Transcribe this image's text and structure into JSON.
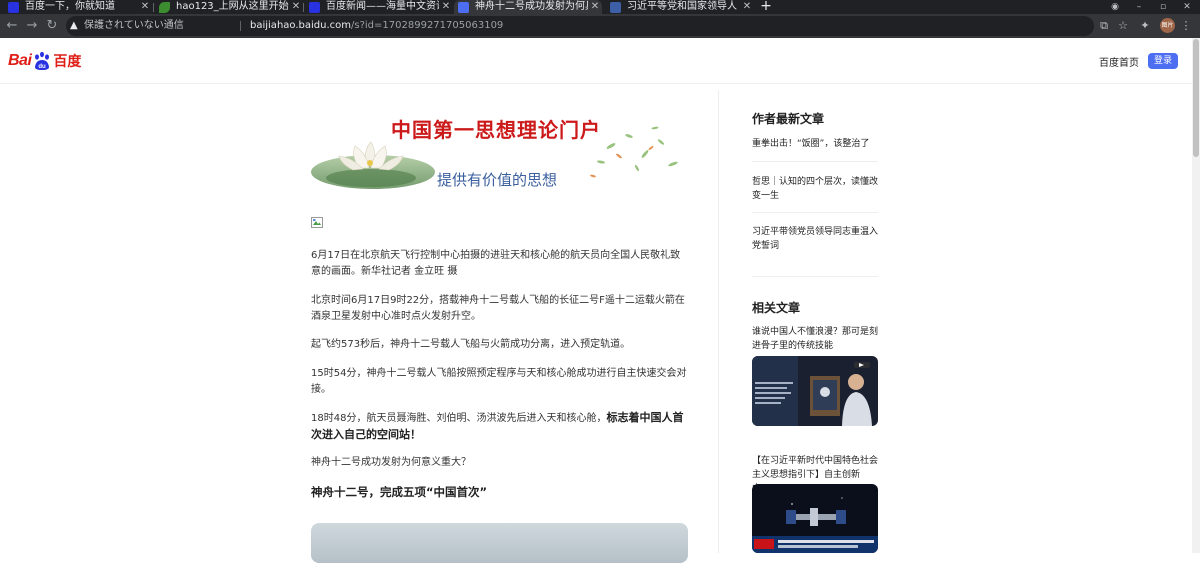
{
  "browser": {
    "tabs": [
      {
        "title": "百度一下，你就知道",
        "active": false
      },
      {
        "title": "hao123_上网从这里开始",
        "active": false
      },
      {
        "title": "百度新闻——海量中文资讯",
        "active": false
      },
      {
        "title": "神舟十二号成功发射为何具",
        "active": true
      },
      {
        "title": "习近平等党和国家领导人",
        "active": false
      }
    ],
    "new_tab": "+",
    "security_label": "保護されていない通信",
    "url_host": "baijiahao.baidu.com",
    "url_path": "/s?id=1702899271705063109",
    "profile_initials": "图片"
  },
  "header": {
    "logo_bai": "Bai",
    "logo_du": "du",
    "logo_cn": "百度",
    "home_link": "百度首页",
    "login_button": "登录"
  },
  "article": {
    "banner_title": "中国第一思想理论门户",
    "banner_subtitle": "提供有价值的思想",
    "paragraphs": [
      "6月17日在北京航天飞行控制中心拍摄的进驻天和核心舱的航天员向全国人民敬礼致意的画面。新华社记者 金立旺 摄",
      "北京时间6月17日9时22分，搭载神舟十二号载人飞船的长征二号F遥十二运载火箭在酒泉卫星发射中心准时点火发射升空。",
      "起飞约573秒后，神舟十二号载人飞船与火箭成功分离，进入预定轨道。",
      "15时54分，神舟十二号载人飞船按照预定程序与天和核心舱成功进行自主快速交会对接。"
    ],
    "para5_normal": "18时48分，航天员聂海胜、刘伯明、汤洪波先后进入天和核心舱，",
    "para5_bold": "标志着中国人首次进入自己的空间站！",
    "question": "神舟十二号成功发射为何意义重大？",
    "subheading": "神舟十二号，完成五项“中国首次”"
  },
  "sidebar": {
    "author_heading": "作者最新文章",
    "author_articles": [
      "重拳出击！“饭圈”，该整治了",
      "哲思｜认知的四个层次，读懂改变一生",
      "习近平带领党员领导同志重温入党誓词"
    ],
    "related_heading": "相关文章",
    "related_articles": [
      "谁说中国人不懂浪漫？那可是刻进骨子里的传统技能",
      "【在习近平新时代中国特色社会主义思想指引下】自主创新 中..."
    ]
  },
  "colors": {
    "baidu_red": "#de1e17",
    "baidu_blue": "#2932e1",
    "login_blue": "#4e6ef2",
    "banner_red": "#cc1a1a"
  }
}
